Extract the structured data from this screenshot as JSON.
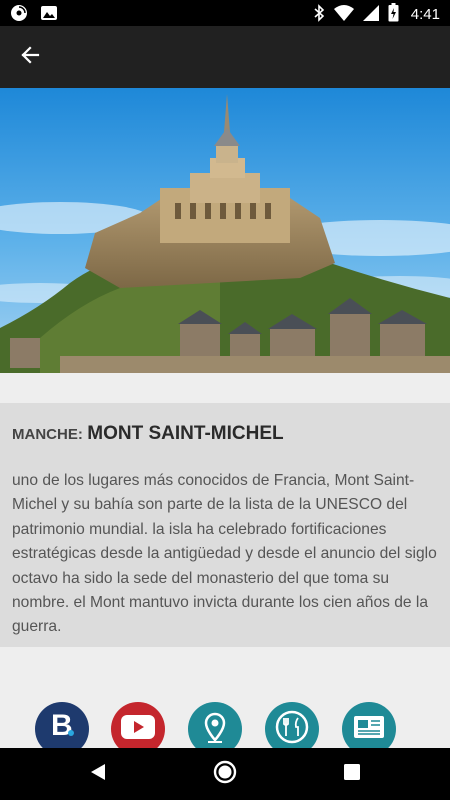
{
  "status_bar": {
    "time": "4:41",
    "left_icons": [
      "music-app-icon",
      "image-notification-icon"
    ],
    "right_icons": [
      "bluetooth-icon",
      "wifi-icon",
      "cell-signal-icon",
      "battery-charging-icon"
    ]
  },
  "app_bar": {
    "back_icon": "arrow-left-icon",
    "background": "#212121"
  },
  "hero": {
    "subject": "mont-saint-michel-photo"
  },
  "place": {
    "region": "MANCHE:",
    "name": "MONT SAINT-MICHEL",
    "description": "uno de los lugares más conocidos de Francia, Mont Saint-Michel y su bahía son parte de la lista de la UNESCO del patrimonio mundial. la isla ha celebrado fortificaciones estratégicas desde la antigüedad y desde el anuncio del siglo octavo ha sido la sede del monasterio del que toma su nombre. el Mont mantuvo invicta durante los cien años de la guerra."
  },
  "actions": [
    {
      "icon": "booking-icon",
      "color": "#1e3a6e"
    },
    {
      "icon": "youtube-icon",
      "color": "#c4262d"
    },
    {
      "icon": "map-pin-icon",
      "color": "#1f8a96"
    },
    {
      "icon": "restaurant-icon",
      "color": "#1f8a96"
    },
    {
      "icon": "newspaper-icon",
      "color": "#1f8a96"
    }
  ],
  "nav_bar": {
    "icons": [
      "back-triangle-icon",
      "home-circle-icon",
      "recents-square-icon"
    ]
  }
}
